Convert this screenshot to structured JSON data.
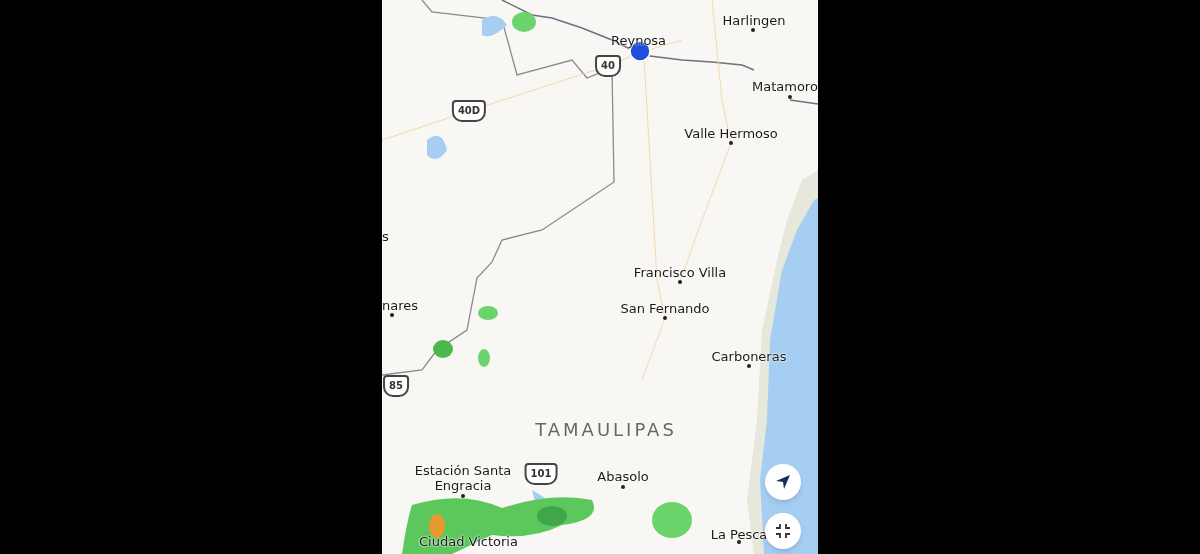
{
  "map": {
    "places": [
      {
        "name": "Harlingen",
        "kind": "city"
      },
      {
        "name": "Reynosa",
        "kind": "city"
      },
      {
        "name": "Matamoro",
        "kind": "city"
      },
      {
        "name": "Valle Hermoso",
        "kind": "city"
      },
      {
        "name": "s",
        "kind": "city"
      },
      {
        "name": "Francisco Villa",
        "kind": "city"
      },
      {
        "name": "nares",
        "kind": "city"
      },
      {
        "name": "San Fernando",
        "kind": "city"
      },
      {
        "name": "Carboneras",
        "kind": "city"
      },
      {
        "name": "TAMAULIPAS",
        "kind": "state"
      },
      {
        "name": "Estación Santa Engracia",
        "kind": "city"
      },
      {
        "name": "Abasolo",
        "kind": "city"
      },
      {
        "name": "Ciudad Victoria",
        "kind": "city"
      },
      {
        "name": "La Pesca",
        "kind": "city"
      }
    ],
    "shields": [
      {
        "label": "40"
      },
      {
        "label": "40D"
      },
      {
        "label": "85"
      },
      {
        "label": "101"
      }
    ],
    "controls": [
      {
        "kind": "locate"
      },
      {
        "kind": "fullscreen"
      }
    ]
  }
}
